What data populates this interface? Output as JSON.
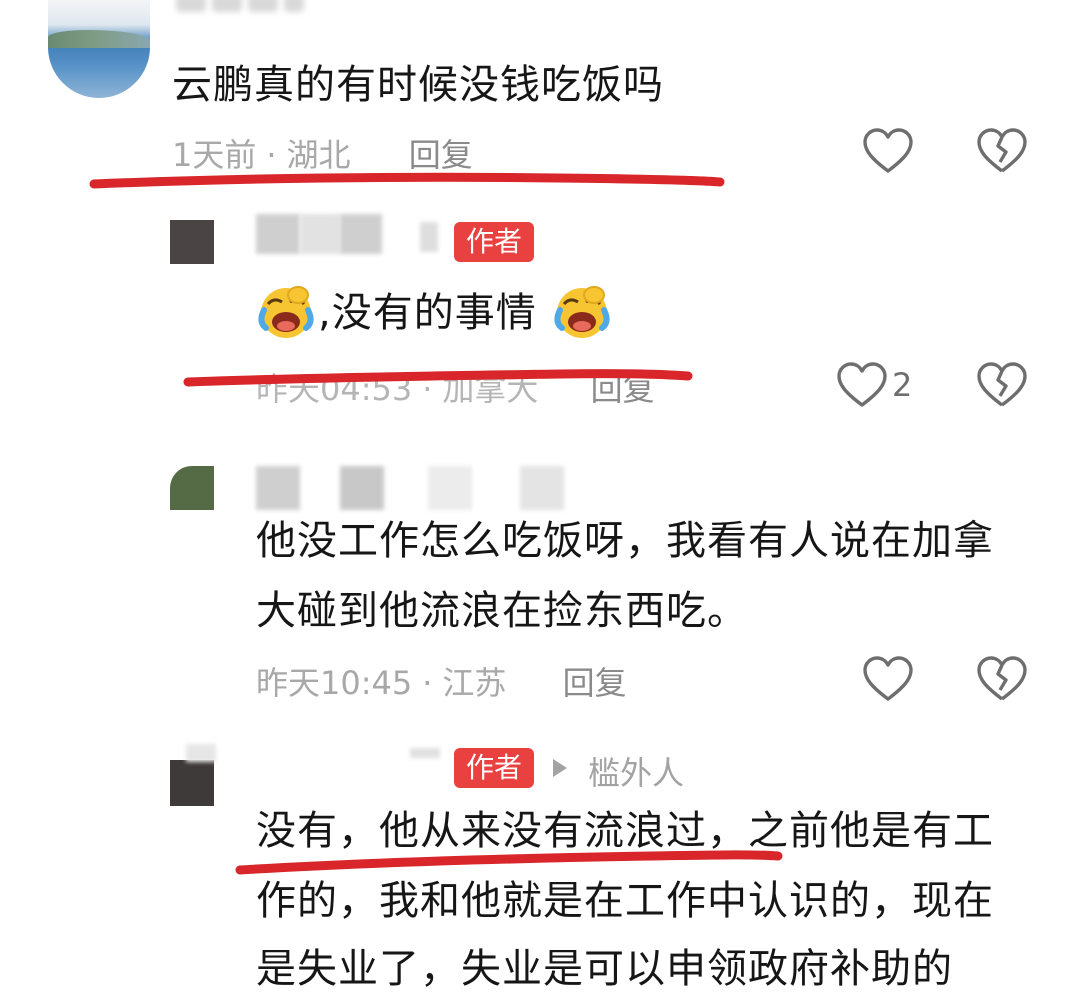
{
  "comments": [
    {
      "text": "云鹏真的有时候没钱吃饭吗",
      "time": "1天前",
      "location": "湖北",
      "reply_label": "回复"
    },
    {
      "author_badge": "作者",
      "text": ",没有的事情",
      "time": "昨天04:53",
      "location": "加拿大",
      "reply_label": "回复",
      "likes": "2"
    },
    {
      "text_line1": "他没工作怎么吃饭呀，我看有人说在加拿",
      "text_line2": "大碰到他流浪在捡东西吃。",
      "time": "昨天10:45",
      "location": "江苏",
      "reply_label": "回复"
    },
    {
      "author_badge": "作者",
      "reply_to": "槛外人",
      "text_line1": "没有，他从来没有流浪过，之前他是有工",
      "text_line2": "作的，我和他就是在工作中认识的，现在",
      "text_line3": "是失业了，失业是可以申领政府补助的"
    }
  ],
  "separator": "·",
  "icons": {
    "like": "heart-outline-icon",
    "dislike": "broken-heart-icon",
    "emoji": "laughing-crying-emoji",
    "reply_arrow": "right-triangle-icon"
  },
  "colors": {
    "annotation_red": "#d9262b",
    "badge_red": "#e8413f",
    "meta_gray": "#a8a8a8"
  }
}
